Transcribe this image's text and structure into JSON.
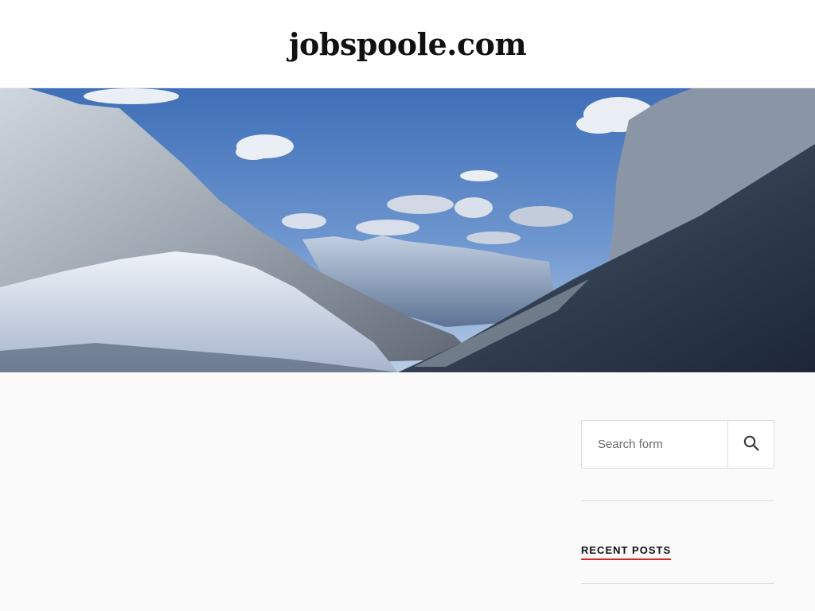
{
  "header": {
    "site_title": "jobspoole.com"
  },
  "hero": {
    "image": "mountain-landscape"
  },
  "sidebar": {
    "search": {
      "placeholder": "Search form",
      "button_icon": "search-icon"
    },
    "recent_posts": {
      "title": "RECENT POSTS"
    }
  },
  "colors": {
    "accent": "#d9281e",
    "background": "#fafafa",
    "header_bg": "#ffffff"
  }
}
